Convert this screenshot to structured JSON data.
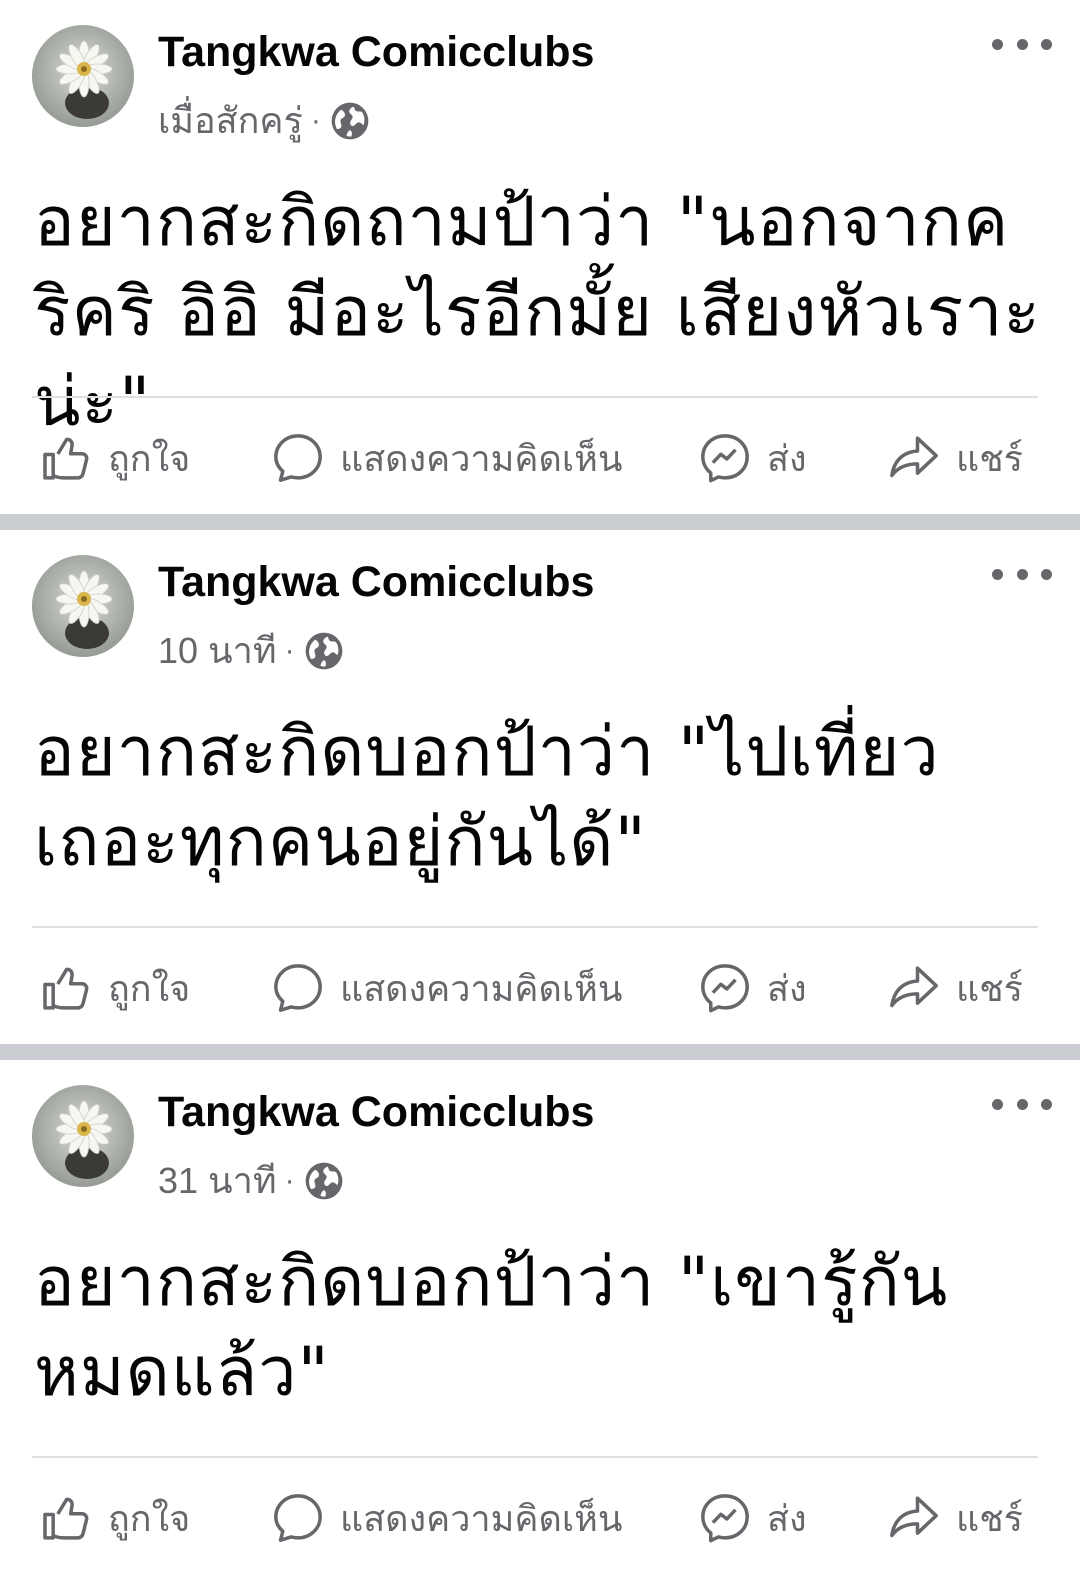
{
  "posts": [
    {
      "author": "Tangkwa Comicclubs",
      "time": "เมื่อสักครู่",
      "separator": "·",
      "text": "อยากสะกิดถามป้าว่า \"นอกจากคริคริ อิอิ มีอะไรอีกมั้ย เสียงหัวเราะน่ะ\"",
      "actions": {
        "like": "ถูกใจ",
        "comment": "แสดงความคิดเห็น",
        "send": "ส่ง",
        "share": "แชร์"
      }
    },
    {
      "author": "Tangkwa Comicclubs",
      "time": "10 นาที",
      "separator": "·",
      "text": "อยากสะกิดบอกป้าว่า \"ไปเที่ยวเถอะทุกคนอยู่กันได้\"",
      "actions": {
        "like": "ถูกใจ",
        "comment": "แสดงความคิดเห็น",
        "send": "ส่ง",
        "share": "แชร์"
      }
    },
    {
      "author": "Tangkwa Comicclubs",
      "time": "31 นาที",
      "separator": "·",
      "text": "อยากสะกิดบอกป้าว่า \"เขารู้กันหมดแล้ว\"",
      "actions": {
        "like": "ถูกใจ",
        "comment": "แสดงความคิดเห็น",
        "send": "ส่ง",
        "share": "แชร์"
      }
    }
  ],
  "icons": {
    "globe": "globe-icon",
    "more": "more-icon",
    "like": "thumbs-up-icon",
    "comment": "comment-bubble-icon",
    "send": "messenger-icon",
    "share": "share-arrow-icon"
  },
  "colors": {
    "text_primary": "#050505",
    "text_secondary": "#65676b",
    "separator": "#c9ccd1",
    "divider": "#dddfe2"
  }
}
